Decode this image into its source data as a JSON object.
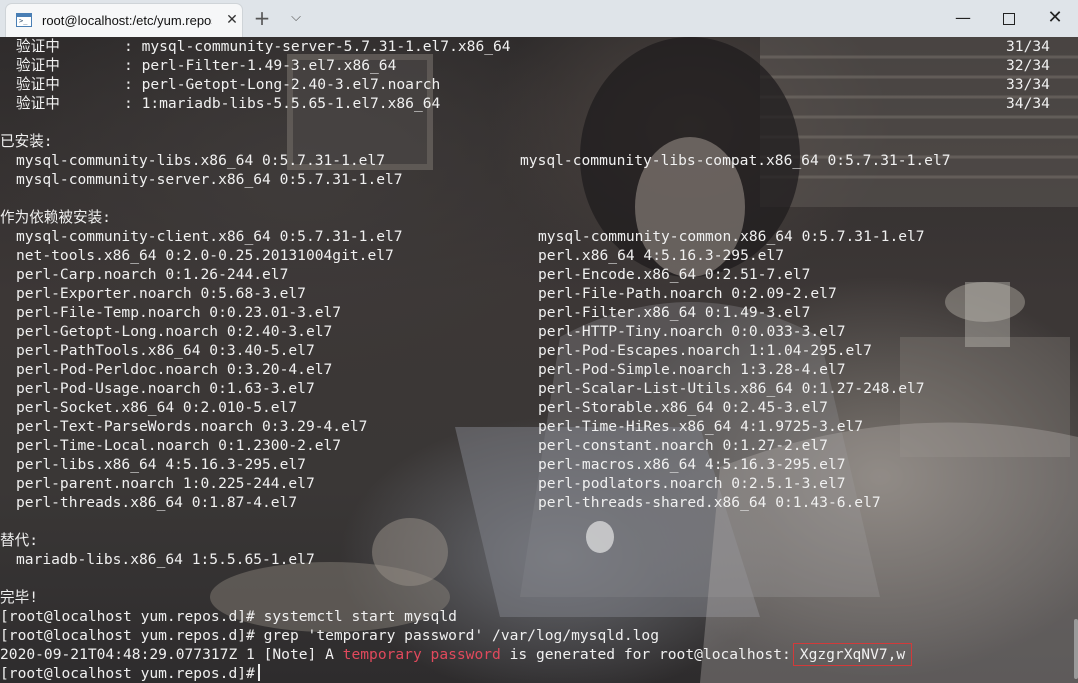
{
  "window": {
    "tab_title": "root@localhost:/etc/yum.repos.d",
    "tab_icon": "terminal-icon",
    "tab_close": "✕",
    "new_tab": "+",
    "tab_menu": "⌵",
    "minimize": "—",
    "close": "✕"
  },
  "terminal": {
    "verify": [
      {
        "label": "验证中",
        "pkg": ": mysql-community-server-5.7.31-1.el7.x86_64",
        "count": "31/34"
      },
      {
        "label": "验证中",
        "pkg": ": perl-Filter-1.49-3.el7.x86_64",
        "count": "32/34"
      },
      {
        "label": "验证中",
        "pkg": ": perl-Getopt-Long-2.40-3.el7.noarch",
        "count": "33/34"
      },
      {
        "label": "验证中",
        "pkg": ": 1:mariadb-libs-5.5.65-1.el7.x86_64",
        "count": "34/34"
      }
    ],
    "installed_heading": "已安装:",
    "installed": [
      {
        "left": "mysql-community-libs.x86_64 0:5.7.31-1.el7",
        "right": "mysql-community-libs-compat.x86_64 0:5.7.31-1.el7"
      },
      {
        "left": "mysql-community-server.x86_64 0:5.7.31-1.el7",
        "right": ""
      }
    ],
    "deps_heading": "作为依赖被安装:",
    "deps": [
      {
        "left": "mysql-community-client.x86_64 0:5.7.31-1.el7",
        "right": "mysql-community-common.x86_64 0:5.7.31-1.el7"
      },
      {
        "left": "net-tools.x86_64 0:2.0-0.25.20131004git.el7",
        "right": "perl.x86_64 4:5.16.3-295.el7"
      },
      {
        "left": "perl-Carp.noarch 0:1.26-244.el7",
        "right": "perl-Encode.x86_64 0:2.51-7.el7"
      },
      {
        "left": "perl-Exporter.noarch 0:5.68-3.el7",
        "right": "perl-File-Path.noarch 0:2.09-2.el7"
      },
      {
        "left": "perl-File-Temp.noarch 0:0.23.01-3.el7",
        "right": "perl-Filter.x86_64 0:1.49-3.el7"
      },
      {
        "left": "perl-Getopt-Long.noarch 0:2.40-3.el7",
        "right": "perl-HTTP-Tiny.noarch 0:0.033-3.el7"
      },
      {
        "left": "perl-PathTools.x86_64 0:3.40-5.el7",
        "right": "perl-Pod-Escapes.noarch 1:1.04-295.el7"
      },
      {
        "left": "perl-Pod-Perldoc.noarch 0:3.20-4.el7",
        "right": "perl-Pod-Simple.noarch 1:3.28-4.el7"
      },
      {
        "left": "perl-Pod-Usage.noarch 0:1.63-3.el7",
        "right": "perl-Scalar-List-Utils.x86_64 0:1.27-248.el7"
      },
      {
        "left": "perl-Socket.x86_64 0:2.010-5.el7",
        "right": "perl-Storable.x86_64 0:2.45-3.el7"
      },
      {
        "left": "perl-Text-ParseWords.noarch 0:3.29-4.el7",
        "right": "perl-Time-HiRes.x86_64 4:1.9725-3.el7"
      },
      {
        "left": "perl-Time-Local.noarch 0:1.2300-2.el7",
        "right": "perl-constant.noarch 0:1.27-2.el7"
      },
      {
        "left": "perl-libs.x86_64 4:5.16.3-295.el7",
        "right": "perl-macros.x86_64 4:5.16.3-295.el7"
      },
      {
        "left": "perl-parent.noarch 1:0.225-244.el7",
        "right": "perl-podlators.noarch 0:2.5.1-3.el7"
      },
      {
        "left": "perl-threads.x86_64 0:1.87-4.el7",
        "right": "perl-threads-shared.x86_64 0:1.43-6.el7"
      }
    ],
    "replaced_heading": "替代:",
    "replaced": [
      "mariadb-libs.x86_64 1:5.5.65-1.el7"
    ],
    "done": "完毕!",
    "prompt": "[root@localhost yum.repos.d]#",
    "cmd1": " systemctl start mysqld",
    "cmd2": " grep 'temporary password' /var/log/mysqld.log",
    "log_prefix": "2020-09-21T04:48:29.077317Z 1 [Note] A ",
    "log_highlight": "temporary password",
    "log_suffix": " is generated for root@localhost:",
    "password": "XgzgrXqNV7,w",
    "highlight_color": "#e0495c",
    "box_color": "#d23a3a"
  }
}
